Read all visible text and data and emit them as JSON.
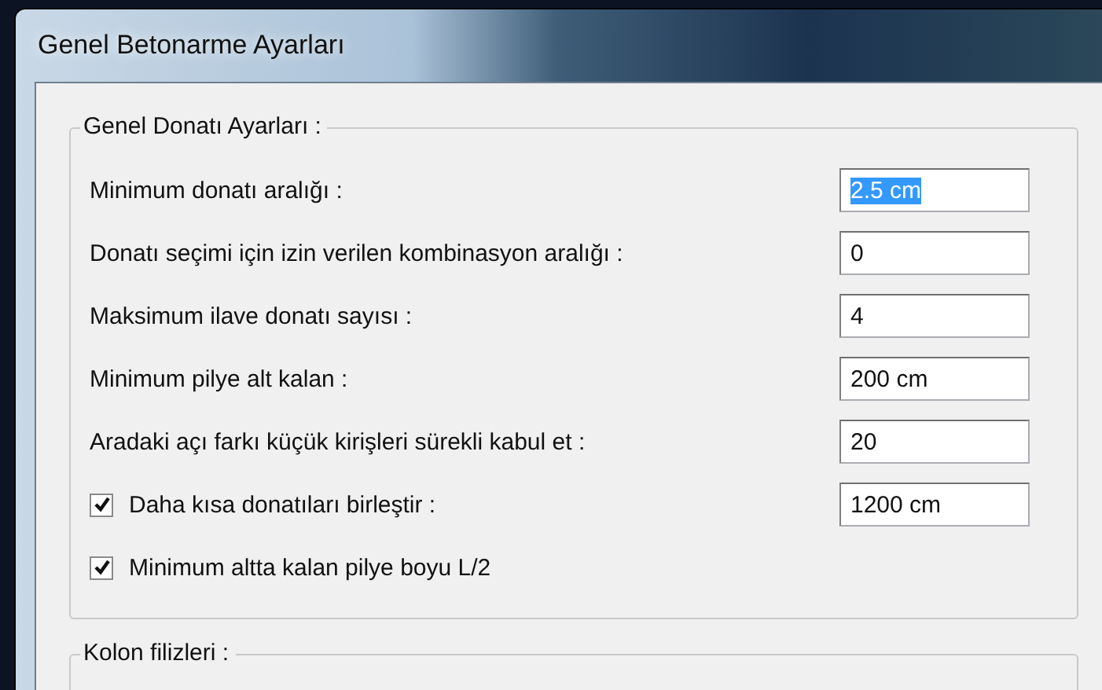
{
  "window": {
    "title": "Genel Betonarme Ayarları"
  },
  "groups": [
    {
      "title": "Genel Donatı Ayarları :",
      "rows": [
        {
          "kind": "field",
          "label": "Minimum donatı aralığı :",
          "field": {
            "value": "2.5 cm",
            "highlighted": true
          }
        },
        {
          "kind": "field",
          "label": "Donatı seçimi için izin verilen kombinasyon aralığı :",
          "field": {
            "value": "0",
            "highlighted": false
          }
        },
        {
          "kind": "field",
          "label": "Maksimum ilave donatı sayısı :",
          "field": {
            "value": "4",
            "highlighted": false
          }
        },
        {
          "kind": "field",
          "label": "Minimum pilye alt kalan :",
          "field": {
            "value": "200 cm",
            "highlighted": false
          }
        },
        {
          "kind": "field",
          "label": "Aradaki açı farkı küçük kirişleri sürekli kabul et :",
          "field": {
            "value": "20",
            "highlighted": false
          }
        },
        {
          "kind": "checkbox",
          "label": "Daha kısa donatıları birleştir :",
          "checked": true,
          "field": {
            "value": "1200 cm",
            "highlighted": false
          }
        },
        {
          "kind": "checkbox",
          "label": "Minimum altta kalan pilye boyu L/2",
          "checked": true
        }
      ]
    },
    {
      "title": "Kolon filizleri :"
    }
  ]
}
